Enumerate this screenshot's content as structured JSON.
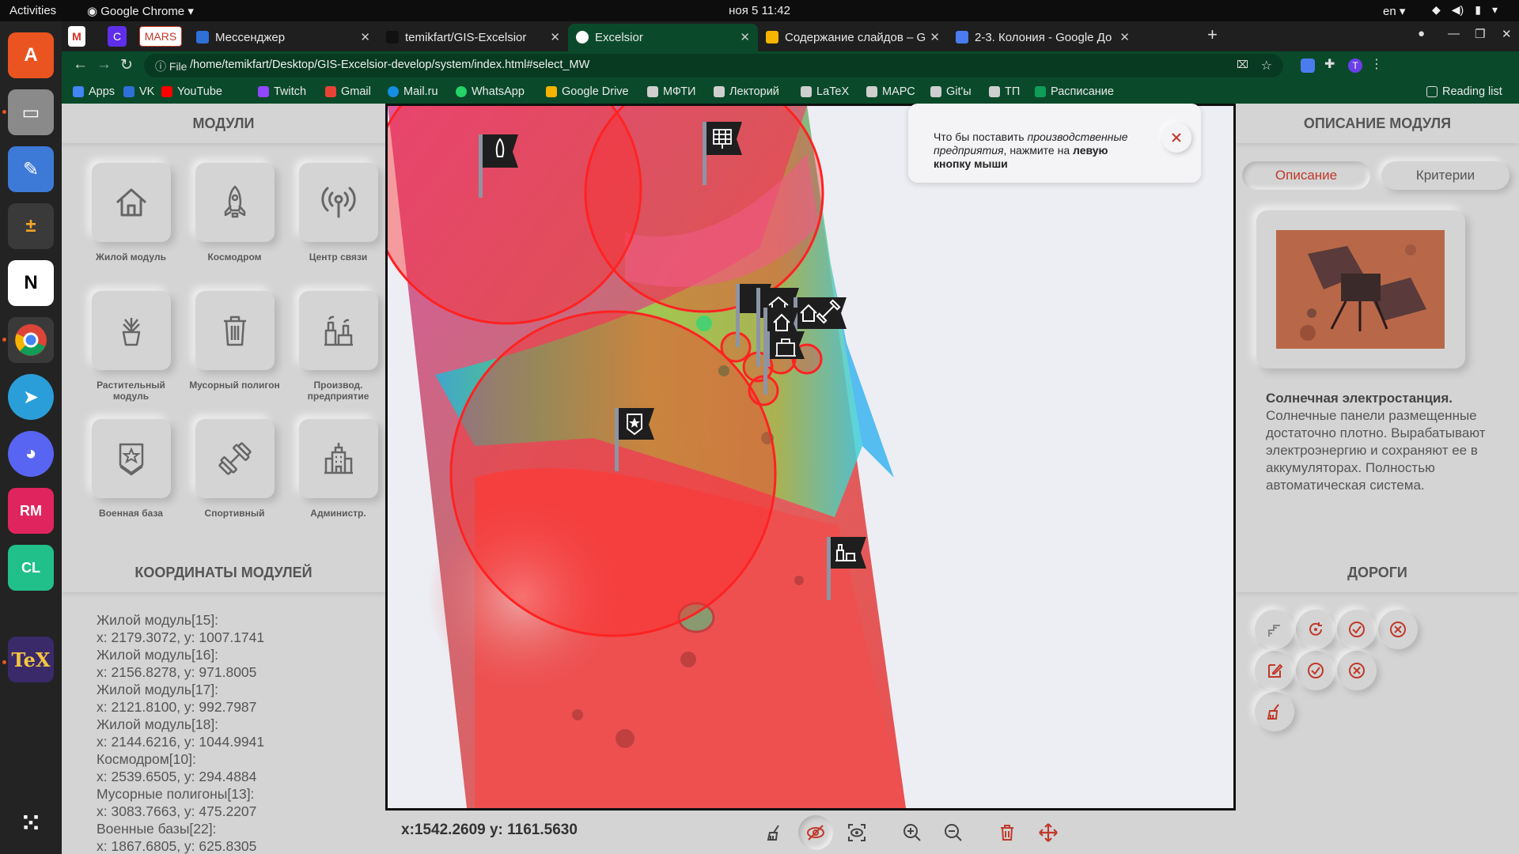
{
  "system": {
    "activities": "Activities",
    "app_name": "Google Chrome",
    "clock": "ноя 5  11:42",
    "language": "en"
  },
  "browser": {
    "pinned": [
      "MARS"
    ],
    "tabs": [
      {
        "label": "Мессенджер",
        "color": "#2f6fd8"
      },
      {
        "label": "temikfart/GIS-Excelsior",
        "color": "#111111"
      },
      {
        "label": "Excelsior",
        "color": "#0b8a4a",
        "active": true
      },
      {
        "label": "Содержание слайдов – G",
        "color": "#f4b400"
      },
      {
        "label": "2-3. Колония - Google До",
        "color": "#4a7cf0"
      }
    ],
    "address": {
      "scheme_label": "File",
      "url": "/home/temikfart/Desktop/GIS-Excelsior-develop/system/index.html#select_MW"
    },
    "bookmarks": [
      "Apps",
      "VK",
      "YouTube",
      "Twitch",
      "Gmail",
      "Mail.ru",
      "WhatsApp",
      "Google Drive",
      "МФТИ",
      "Лекторий",
      "LaTeX",
      "МАРС",
      "Git'ы",
      "ТП",
      "Расписание"
    ],
    "reading_list": "Reading list"
  },
  "left_panel": {
    "modules_title": "МОДУЛИ",
    "modules": [
      {
        "label": "Жилой модуль",
        "icon": "house-icon"
      },
      {
        "label": "Космодром",
        "icon": "rocket-icon"
      },
      {
        "label": "Центр связи",
        "icon": "antenna-icon"
      },
      {
        "label": "Растительный модуль",
        "icon": "plant-icon"
      },
      {
        "label": "Мусорный полигон",
        "icon": "trash-icon"
      },
      {
        "label": "Производ. предприятие",
        "icon": "factory-icon"
      },
      {
        "label": "Военная база",
        "icon": "military-badge-icon"
      },
      {
        "label": "Спортивный",
        "icon": "dumbbell-icon"
      },
      {
        "label": "Администр.",
        "icon": "admin-building-icon"
      }
    ],
    "coords_title": "КООРДИНАТЫ МОДУЛЕЙ",
    "coords": [
      {
        "name": "Жилой модуль[15]:",
        "xy": "x: 2179.3072, y: 1007.1741"
      },
      {
        "name": "Жилой модуль[16]:",
        "xy": "x: 2156.8278, y: 971.8005"
      },
      {
        "name": "Жилой модуль[17]:",
        "xy": "x: 2121.8100, y: 992.7987"
      },
      {
        "name": "Жилой модуль[18]:",
        "xy": "x: 2144.6216, y: 1044.9941"
      },
      {
        "name": "Космодром[10]:",
        "xy": "x: 2539.6505, y: 294.4884"
      },
      {
        "name": "Мусорные полигоны[13]:",
        "xy": "x: 3083.7663, y: 475.2207"
      },
      {
        "name": "Военные базы[22]:",
        "xy": "x: 1867.6805, y: 625.8305"
      }
    ]
  },
  "map": {
    "cursor_position": "x:1542.2609 y: 1161.5630",
    "hint": {
      "prefix": "Что бы поставить ",
      "emph": "производственные предприятия",
      "middle": ", нажмите на ",
      "strong": "левую кнопку мыши"
    }
  },
  "right_panel": {
    "title": "ОПИСАНИЕ МОДУЛЯ",
    "tabs": [
      "Описание",
      "Критерии"
    ],
    "desc_title": "Солнечная электростанция.",
    "desc_body": "Солнечные панели размещенные достаточно плотно. Вырабатывают электроэнергию и сохраняют ее в аккумуляторах. Полностью автоматическая система.",
    "roads_title": "ДОРОГИ"
  },
  "colors": {
    "accent_red": "#c0392b",
    "panel_bg": "#d4d4d4",
    "chrome_green": "#0a4a2a"
  }
}
